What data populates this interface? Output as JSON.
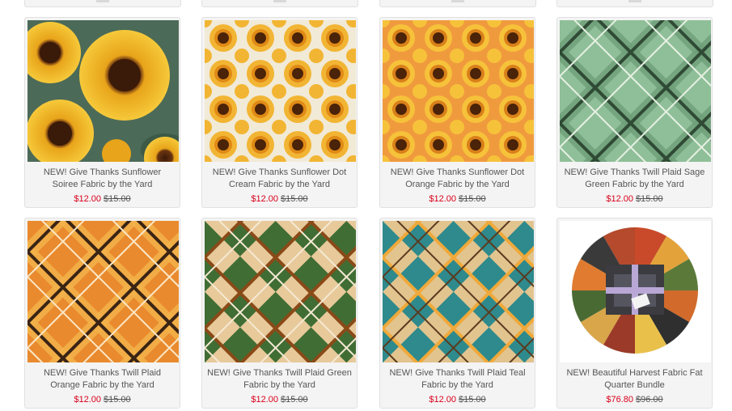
{
  "colors": {
    "sale": "#d9001b",
    "text": "#555555",
    "card_bg": "#f4f4f4",
    "border": "#e1e1e1"
  },
  "products": [
    {
      "title": "NEW! Give Thanks Sunflower Soiree Fabric by the Yard",
      "sale_price": "$12.00",
      "original_price": "$15.00",
      "swatch": "sunflower-soiree"
    },
    {
      "title": "NEW! Give Thanks Sunflower Dot Cream Fabric by the Yard",
      "sale_price": "$12.00",
      "original_price": "$15.00",
      "swatch": "sunflower-dot-cream"
    },
    {
      "title": "NEW! Give Thanks Sunflower Dot Orange Fabric by the Yard",
      "sale_price": "$12.00",
      "original_price": "$15.00",
      "swatch": "sunflower-dot-orange"
    },
    {
      "title": "NEW! Give Thanks Twill Plaid Sage Green Fabric by the Yard",
      "sale_price": "$12.00",
      "original_price": "$15.00",
      "swatch": "plaid-sage"
    },
    {
      "title": "NEW! Give Thanks Twill Plaid Orange Fabric by the Yard",
      "sale_price": "$12.00",
      "original_price": "$15.00",
      "swatch": "plaid-orange"
    },
    {
      "title": "NEW! Give Thanks Twill Plaid Green Fabric by the Yard",
      "sale_price": "$12.00",
      "original_price": "$15.00",
      "swatch": "plaid-green"
    },
    {
      "title": "NEW! Give Thanks Twill Plaid Teal Fabric by the Yard",
      "sale_price": "$12.00",
      "original_price": "$15.00",
      "swatch": "plaid-teal"
    },
    {
      "title": "NEW! Beautiful Harvest Fabric Fat Quarter Bundle",
      "sale_price": "$76.80",
      "original_price": "$96.00",
      "swatch": "fat-quarter-bundle"
    }
  ]
}
